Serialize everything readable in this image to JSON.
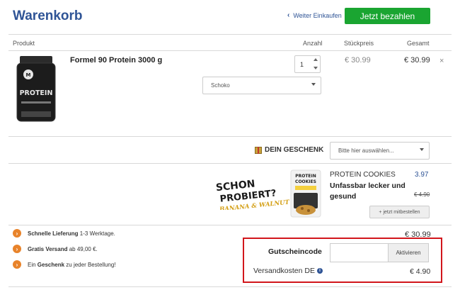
{
  "header": {
    "title": "Warenkorb",
    "continue_label": "Weiter Einkaufen",
    "pay_label": "Jetzt bezahlen"
  },
  "table": {
    "columns": [
      "Produkt",
      "Anzahl",
      "Stückpreis",
      "Gesamt"
    ]
  },
  "item": {
    "name": "Formel 90 Protein 3000 g",
    "image_brand": "PROTEIN",
    "quantity": "1",
    "flavor": "Schoko",
    "unit_price": "€ 30.99",
    "total": "€ 30.99",
    "remove_symbol": "×"
  },
  "gift": {
    "label": "DEIN GESCHENK",
    "select_placeholder": "Bitte hier auswählen..."
  },
  "promo": {
    "headline_line1": "SCHON",
    "headline_line2": "PROBIERT?",
    "headline_line3": "BANANA & WALNUT",
    "pack_label_line1": "PROTEIN",
    "pack_label_line2": "COOKIES",
    "product_title": "PROTEIN COOKIES",
    "price": "3.97",
    "description": "Unfassbar lecker und gesund",
    "old_price": "€ 4.90",
    "add_button": "+ jetzt mitbestellen"
  },
  "features": [
    {
      "bold": "Schnelle Lieferung",
      "rest": " 1-3 Werktage."
    },
    {
      "bold": "Gratis Versand",
      "rest": " ab 49,00 €."
    },
    {
      "pre": "Ein ",
      "bold": "Geschenk",
      "rest": " zu jeder Bestellung!"
    }
  ],
  "summary": {
    "subtotal": "€ 30.99",
    "coupon_label": "Gutscheincode",
    "coupon_placeholder": "",
    "coupon_button": "Aktivieren",
    "shipping_label": "Versandkosten DE",
    "shipping_value": "€ 4.90"
  },
  "colors": {
    "title_blue": "#2f5496",
    "pay_green": "#1aa531",
    "highlight_red": "#d2161c",
    "feature_orange": "#e8832a"
  }
}
